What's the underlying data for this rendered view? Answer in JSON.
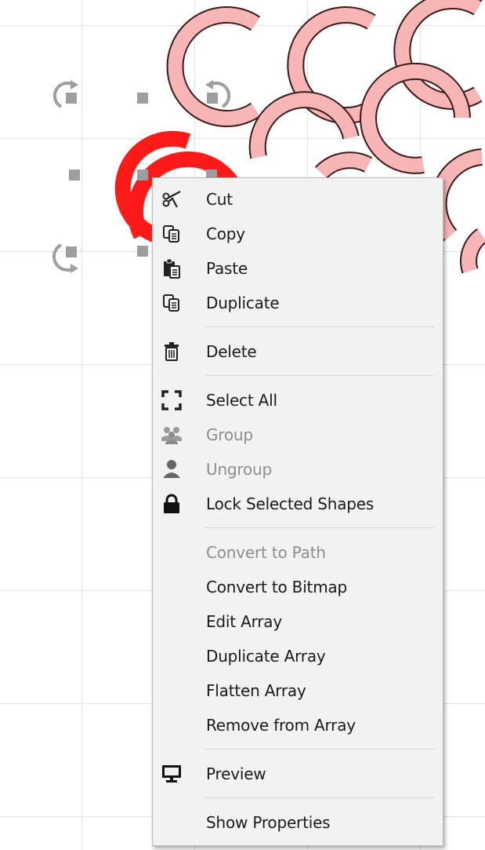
{
  "context_menu": {
    "items": [
      {
        "label": "Cut",
        "icon": "scissors-icon",
        "enabled": true
      },
      {
        "label": "Copy",
        "icon": "copy-icon",
        "enabled": true
      },
      {
        "label": "Paste",
        "icon": "paste-icon",
        "enabled": true
      },
      {
        "label": "Duplicate",
        "icon": "duplicate-icon",
        "enabled": true
      },
      {
        "label": "Delete",
        "icon": "trash-icon",
        "enabled": true
      },
      {
        "label": "Select All",
        "icon": "select-all-icon",
        "enabled": true
      },
      {
        "label": "Group",
        "icon": "group-icon",
        "enabled": false
      },
      {
        "label": "Ungroup",
        "icon": "ungroup-icon",
        "enabled": false
      },
      {
        "label": "Lock Selected Shapes",
        "icon": "lock-icon",
        "enabled": true
      },
      {
        "label": "Convert to Path",
        "icon": "",
        "enabled": false
      },
      {
        "label": "Convert to Bitmap",
        "icon": "",
        "enabled": true
      },
      {
        "label": "Edit Array",
        "icon": "",
        "enabled": true
      },
      {
        "label": "Duplicate Array",
        "icon": "",
        "enabled": true
      },
      {
        "label": "Flatten Array",
        "icon": "",
        "enabled": true
      },
      {
        "label": "Remove from Array",
        "icon": "",
        "enabled": true
      },
      {
        "label": "Preview",
        "icon": "monitor-icon",
        "enabled": true
      },
      {
        "label": "Show Properties",
        "icon": "",
        "enabled": true
      }
    ]
  },
  "colors": {
    "selected_shape": "#ff1a1a",
    "shape_fill": "#f7b5b5",
    "shape_stroke": "#3a1a1a",
    "menu_bg": "#f2f2f2",
    "disabled_text": "#8d8d8d"
  }
}
